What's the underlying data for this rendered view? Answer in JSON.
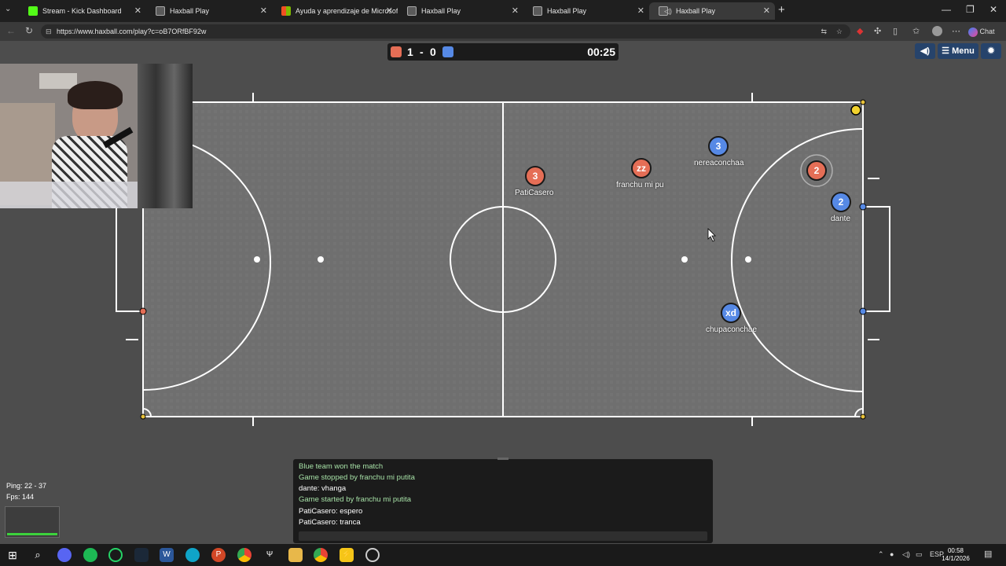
{
  "browser": {
    "tabs": [
      {
        "title": "Stream - Kick Dashboard",
        "favicon": "kick-icon",
        "color": "#53fc18"
      },
      {
        "title": "Haxball Play",
        "favicon": "haxball-icon",
        "color": "#5a5a5a"
      },
      {
        "title": "Ayuda y aprendizaje de Microsoft",
        "favicon": "microsoft-icon",
        "color": "#f25022"
      },
      {
        "title": "Haxball Play",
        "favicon": "haxball-icon",
        "color": "#5a5a5a"
      },
      {
        "title": "Haxball Play",
        "favicon": "haxball-icon",
        "color": "#5a5a5a"
      },
      {
        "title": "Haxball Play",
        "favicon": "haxball-icon",
        "color": "#5a5a5a"
      }
    ],
    "url": "https://www.haxball.com/play?c=oB7ORfBF92w",
    "chat_button": "Chat"
  },
  "game": {
    "score_red": "1",
    "score_sep": "-",
    "score_blue": "0",
    "time": "00:25",
    "menu_label": "Menu",
    "red_color": "#e56e56",
    "blue_color": "#5689e5",
    "players": [
      {
        "team": "red",
        "number": "3",
        "name": "PatiCasero"
      },
      {
        "team": "red",
        "number": "zz",
        "name": "franchu mi pu"
      },
      {
        "team": "blue",
        "number": "3",
        "name": "nereaconchaa"
      },
      {
        "team": "red",
        "number": "2",
        "name": ""
      },
      {
        "team": "blue",
        "number": "2",
        "name": "dante"
      },
      {
        "team": "blue",
        "number": "xd",
        "name": "chupaconchae"
      }
    ],
    "chat": [
      {
        "text": "Blue team won the match",
        "type": "system"
      },
      {
        "text": "Game stopped by franchu mi putita",
        "type": "system"
      },
      {
        "text": "dante: vhanga",
        "type": "user"
      },
      {
        "text": "Game started by franchu mi putita",
        "type": "system"
      },
      {
        "text": "PatiCasero: espero",
        "type": "user"
      },
      {
        "text": "PatiCasero: tranca",
        "type": "user"
      }
    ],
    "ping": "Ping: 22 - 37",
    "fps": "Fps: 144"
  },
  "taskbar": {
    "language": "ESP",
    "time": "00:58",
    "date": "14/1/2026"
  }
}
